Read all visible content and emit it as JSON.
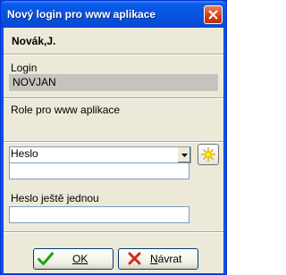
{
  "window": {
    "title": "Nový login pro www aplikace",
    "close_icon": "close-icon"
  },
  "user": {
    "name": "Novák,J."
  },
  "login": {
    "label": "Login",
    "value": "NOVJAN"
  },
  "role": {
    "label": "Role pro www aplikace",
    "value": "",
    "dropdown_icon": "chevron-down-icon",
    "new_role_icon": "sparkle-new-icon"
  },
  "password": {
    "label": "Heslo",
    "value": ""
  },
  "password_repeat": {
    "label": "Heslo ještě jednou",
    "value": ""
  },
  "buttons": {
    "ok": {
      "label": "OK",
      "icon": "checkmark-icon"
    },
    "back": {
      "label_first": "N",
      "label_rest": "ávrat",
      "icon": "cross-icon"
    }
  },
  "colors": {
    "title_bar": "#0752e0",
    "dialog_bg": "#ece9d8",
    "readonly_field": "#c4c3bf",
    "ok_check": "#1aa31a",
    "back_cross": "#d8261a",
    "close_button": "#d23d13"
  }
}
